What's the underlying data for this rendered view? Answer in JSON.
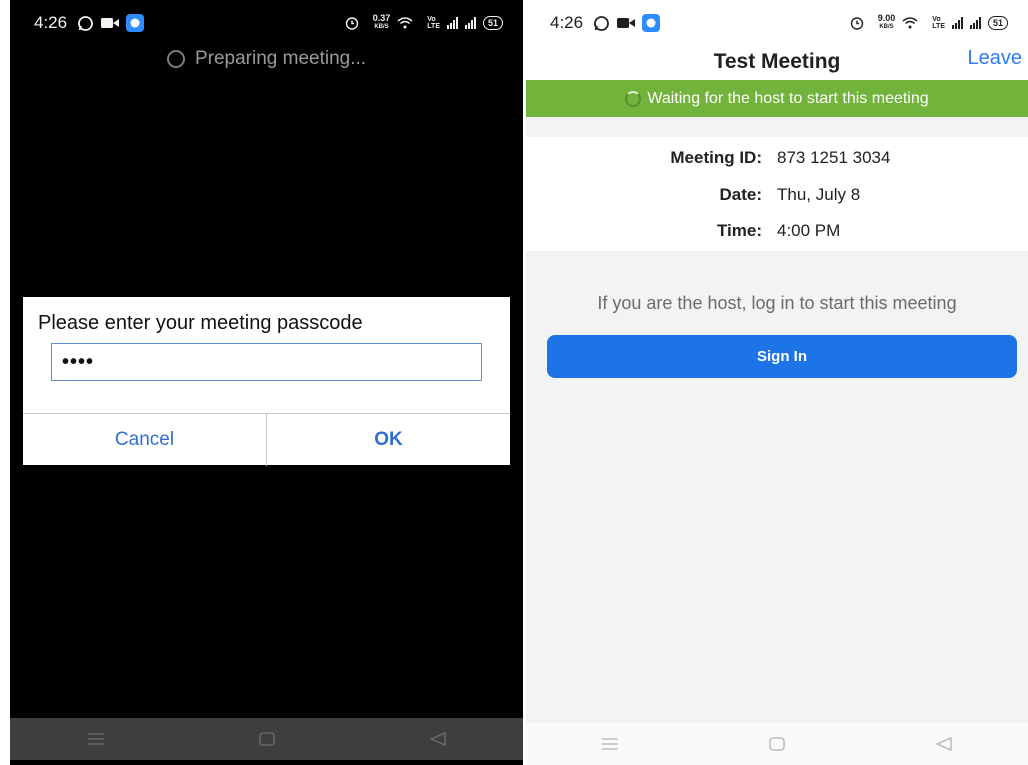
{
  "left_screen": {
    "status_bar": {
      "time": "4:26",
      "net_speed_value": "0.37",
      "net_speed_unit": "KB/S",
      "volte_top": "Vo",
      "volte_bottom": "LTE",
      "battery": "51"
    },
    "preparing_text": "Preparing meeting...",
    "dialog": {
      "title": "Please enter your meeting passcode",
      "passcode_value": "••••",
      "cancel_label": "Cancel",
      "ok_label": "OK"
    }
  },
  "right_screen": {
    "status_bar": {
      "time": "4:26",
      "net_speed_value": "9.00",
      "net_speed_unit": "KB/S",
      "volte_top": "Vo",
      "volte_bottom": "LTE",
      "battery": "51"
    },
    "header": {
      "title": "Test Meeting",
      "leave_label": "Leave"
    },
    "waiting_banner": "Waiting for the host to start this meeting",
    "meeting_info": {
      "id_label": "Meeting ID:",
      "id_value": "873 1251 3034",
      "date_label": "Date:",
      "date_value": "Thu, July 8",
      "time_label": "Time:",
      "time_value": "4:00 PM"
    },
    "host_hint": "If you are the host, log in to start this meeting",
    "sign_in_label": "Sign In"
  },
  "icons": {
    "status_left": [
      "whatsapp-icon",
      "video-camera-icon",
      "app-notification-icon"
    ],
    "status_right": [
      "alarm-icon",
      "wifi-icon",
      "signal-icon",
      "battery-icon"
    ],
    "navigation": [
      "menu-icon",
      "home-icon",
      "back-icon"
    ]
  },
  "colors": {
    "banner_green": "#72b33b",
    "sign_in_blue": "#1d74e7",
    "link_blue": "#2d7cf6",
    "dialog_button_blue": "#2e6fd1"
  }
}
